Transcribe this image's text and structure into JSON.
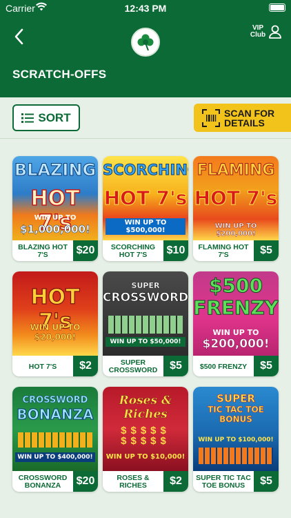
{
  "status": {
    "carrier": "Carrier",
    "time": "12:43 PM"
  },
  "header": {
    "vip": "VIP\nClub",
    "title": "SCRATCH-OFFS"
  },
  "toolbar": {
    "sort": "SORT",
    "scan": "SCAN FOR\nDETAILS"
  },
  "colors": {
    "brand_green": "#0b6a35",
    "accent_yellow": "#f2c31a",
    "background": "#e6f0e6"
  },
  "games": [
    {
      "name": "BLAZING HOT 7'S",
      "price": "$20",
      "art_title1": "BLAZING",
      "art_title2": "HOT 7's",
      "art_prize1": "WIN UP TO",
      "art_prize2": "$1,000,000!"
    },
    {
      "name": "SCORCHING HOT 7'S",
      "price": "$10",
      "art_title1": "SCORCHING",
      "art_title2": "HOT 7's",
      "art_prize1": "WIN UP TO $500,000!",
      "art_prize2": ""
    },
    {
      "name": "FLAMING HOT 7'S",
      "price": "$5",
      "art_title1": "FLAMING",
      "art_title2": "HOT 7's",
      "art_prize1": "WIN UP TO $200,000!",
      "art_prize2": ""
    },
    {
      "name": "HOT 7'S",
      "price": "$2",
      "art_title1": "HOT 7's",
      "art_title2": "",
      "art_prize1": "WIN UP TO $20,000!",
      "art_prize2": ""
    },
    {
      "name": "SUPER CROSSWORD",
      "price": "$5",
      "art_title1": "SUPER",
      "art_title2": "CROSSWORD",
      "art_prize1": "WIN UP TO $50,000!",
      "art_prize2": ""
    },
    {
      "name": "$500 FRENZY",
      "price": "$5",
      "art_title1": "$500",
      "art_title2": "FRENZY",
      "art_prize1": "WIN UP TO",
      "art_prize2": "$200,000!"
    },
    {
      "name": "CROSSWORD BONANZA",
      "price": "$20",
      "art_title1": "CROSSWORD",
      "art_title2": "BONANZA",
      "art_prize1": "WIN UP TO $400,000!",
      "art_prize2": ""
    },
    {
      "name": "ROSES & RICHES",
      "price": "$2",
      "art_title1": "Roses & Riches",
      "art_title2": "",
      "art_prize1": "WIN UP TO $10,000!",
      "art_prize2": ""
    },
    {
      "name": "SUPER TIC TAC TOE BONUS",
      "price": "$5",
      "art_title1": "SUPER",
      "art_title2": "TIC TAC TOE BONUS",
      "art_prize1": "WIN UP TO $100,000!",
      "art_prize2": ""
    }
  ]
}
